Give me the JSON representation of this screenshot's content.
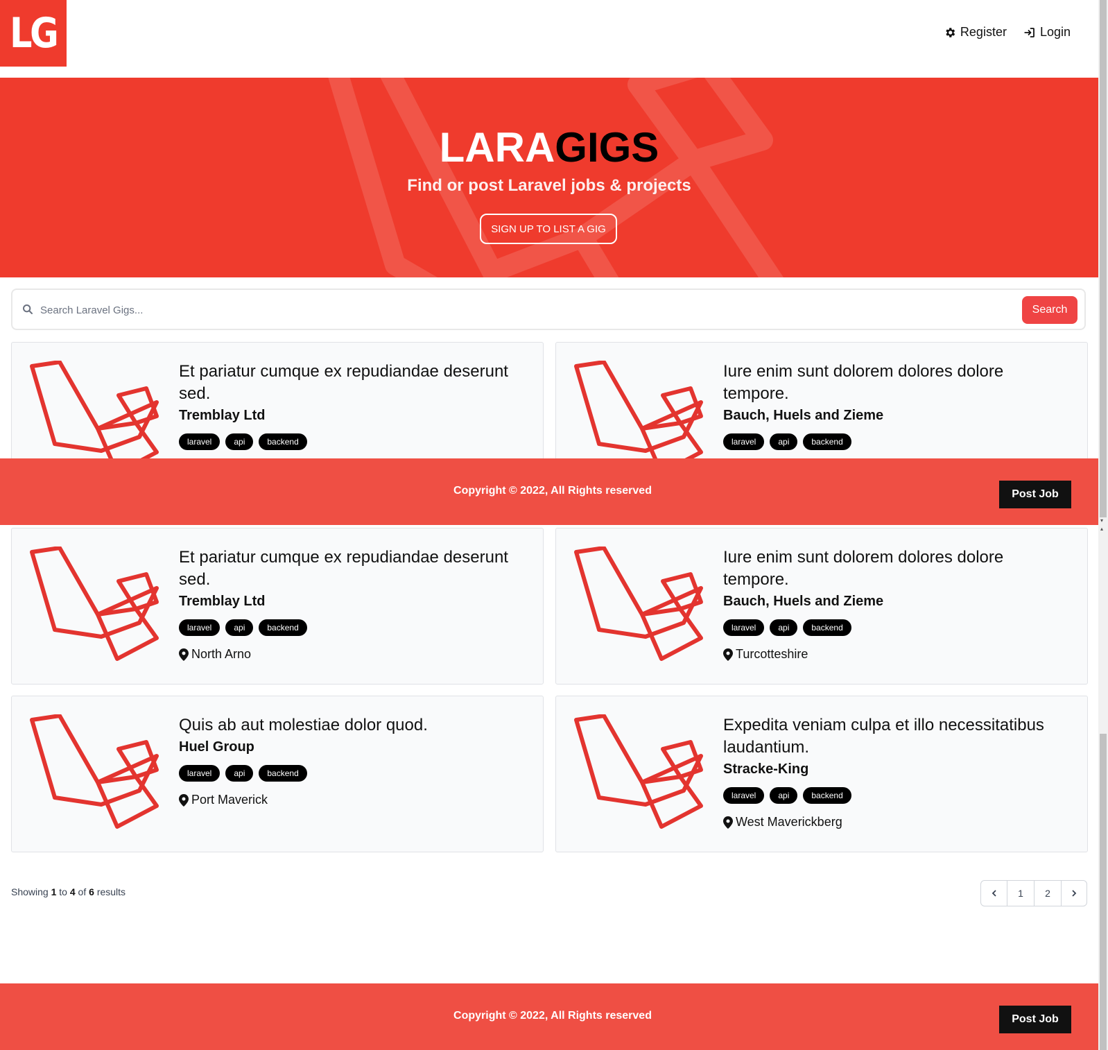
{
  "nav": {
    "logo_text": "LG",
    "register_label": "Register",
    "login_label": "Login"
  },
  "hero": {
    "title_lara": "LARA",
    "title_gigs": "GIGS",
    "subtitle": "Find or post Laravel jobs & projects",
    "cta_label": "SIGN UP TO LIST A GIG"
  },
  "search": {
    "placeholder": "Search Laravel Gigs...",
    "button_label": "Search"
  },
  "listings": [
    {
      "title": "Et pariatur cumque ex repudiandae deserunt sed.",
      "company": "Tremblay Ltd",
      "tags": [
        "laravel",
        "api",
        "backend"
      ],
      "location": "North Arno"
    },
    {
      "title": "Iure enim sunt dolorem dolores dolore tempore.",
      "company": "Bauch, Huels and Zieme",
      "tags": [
        "laravel",
        "api",
        "backend"
      ],
      "location": "Turcotteshire"
    },
    {
      "title": "Et pariatur cumque ex repudiandae deserunt sed.",
      "company": "Tremblay Ltd",
      "tags": [
        "laravel",
        "api",
        "backend"
      ],
      "location": "North Arno"
    },
    {
      "title": "Iure enim sunt dolorem dolores dolore tempore.",
      "company": "Bauch, Huels and Zieme",
      "tags": [
        "laravel",
        "api",
        "backend"
      ],
      "location": "Turcotteshire"
    },
    {
      "title": "Quis ab aut molestiae dolor quod.",
      "company": "Huel Group",
      "tags": [
        "laravel",
        "api",
        "backend"
      ],
      "location": "Port Maverick"
    },
    {
      "title": "Expedita veniam culpa et illo necessitatibus laudantium.",
      "company": "Stracke-King",
      "tags": [
        "laravel",
        "api",
        "backend"
      ],
      "location": "West Maverickberg"
    }
  ],
  "pagination": {
    "showing_prefix": "Showing",
    "from": "1",
    "to_word": "to",
    "to": "4",
    "of_word": "of",
    "total": "6",
    "results_word": "results",
    "pages": [
      "1",
      "2"
    ]
  },
  "footer": {
    "copyright": "Copyright © 2022, All Rights reserved",
    "post_job_label": "Post Job"
  },
  "colors": {
    "brand_red": "#ef3b2d",
    "footer_red": "#ef4f44",
    "button_red": "#ef4444"
  },
  "icons": {
    "register": "gear-icon",
    "login": "sign-in-icon",
    "search": "search-icon",
    "location": "map-marker-icon",
    "prev": "chevron-left-icon",
    "next": "chevron-right-icon"
  }
}
